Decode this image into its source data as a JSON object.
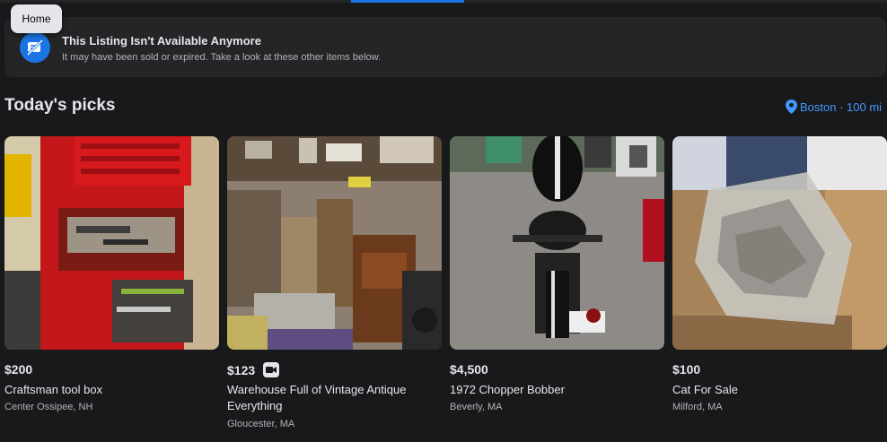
{
  "tooltip": {
    "label": "Home"
  },
  "banner": {
    "title": "This Listing Isn't Available Anymore",
    "subtitle": "It may have been sold or expired. Take a look at these other items below."
  },
  "section": {
    "title": "Today's picks",
    "location": "Boston · 100 mi"
  },
  "listings": [
    {
      "price": "$200",
      "title": "Craftsman tool box",
      "location": "Center Ossipee, NH",
      "has_video": false
    },
    {
      "price": "$123",
      "title": "Warehouse Full of Vintage Antique Everything",
      "location": "Gloucester, MA",
      "has_video": true
    },
    {
      "price": "$4,500",
      "title": "1972 Chopper Bobber",
      "location": "Beverly, MA",
      "has_video": false
    },
    {
      "price": "$100",
      "title": "Cat For Sale",
      "location": "Milford, MA",
      "has_video": false
    }
  ],
  "colors": {
    "accent": "#1b74e4",
    "link": "#4599ff",
    "background": "#18191a",
    "surface": "#242526"
  }
}
